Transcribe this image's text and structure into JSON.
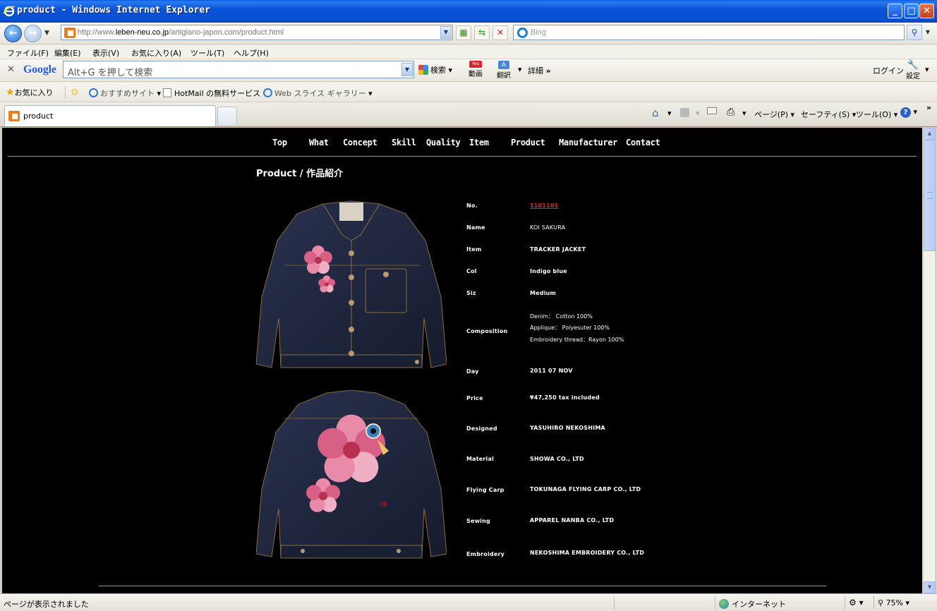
{
  "window": {
    "title": "product - Windows Internet Explorer",
    "minimize": "_",
    "maximize": "□",
    "close": "✕"
  },
  "address": {
    "url_prefix": "http://www.",
    "url_domain": "leben-neu.co.jp",
    "url_path": "/artigiano-japon.com/product.html",
    "search_placeholder": "Bing"
  },
  "menu": [
    "ファイル(F)",
    "編集(E)",
    "表示(V)",
    "お気に入り(A)",
    "ツール(T)",
    "ヘルプ(H)"
  ],
  "google_toolbar": {
    "logo": "Google",
    "search_placeholder": "Alt+G を押して検索",
    "search_label": "検索",
    "video_label": "動画",
    "translate_label": "翻訳",
    "details_label": "詳細",
    "login_label": "ログイン",
    "settings_label": "設定"
  },
  "favorites": {
    "favorites_label": "お気に入り",
    "suggested_sites": "おすすめサイト",
    "hotmail": "HotMail の無料サービス",
    "web_slice": "Web スライス ギャラリー"
  },
  "tab": {
    "label": "product"
  },
  "command_bar": {
    "page": "ページ(P)",
    "safety": "セーフティ(S)",
    "tools": "ツール(O)"
  },
  "site_nav": [
    "Top",
    "What",
    "Concept",
    "Skill",
    "Quality",
    "Item",
    "Product",
    "Manufacturer",
    "Contact"
  ],
  "page_title": "Product / 作品紹介",
  "spec": {
    "no_label": "No.",
    "no_value": "1101101",
    "name_label": "Name",
    "name_value": "KOI SAKURA",
    "item_label": "Item",
    "item_value": "TRACKER JACKET",
    "col_label": "Col",
    "col_value": "Indigo blue",
    "siz_label": "Siz",
    "siz_value": "Medium",
    "composition_label": "Composition",
    "composition_lines": [
      "Denim： Cotton 100%",
      "Applique： Polyesuter  100%",
      "Embroidery thread：Rayon 100%"
    ],
    "day_label": "Day",
    "day_value": "2011 07 NOV",
    "price_label": "Price",
    "price_value": "¥47,250 tax included",
    "designed_label": "Designed",
    "designed_value": "YASUHIRO NEKOSHIMA",
    "material_label": "Material",
    "material_value": "SHOWA CO., LTD",
    "flying_carp_label": "Flying Carp",
    "flying_carp_value": "TOKUNAGA FLYING CARP CO., LTD",
    "sewing_label": "Sewing",
    "sewing_value": "APPAREL NANBA CO., LTD",
    "embroidery_label": "Embroidery",
    "embroidery_value": "NEKOSHIMA EMBROIDERY  CO., LTD"
  },
  "status": {
    "text": "ページが表示されました",
    "zone": "インターネット",
    "zoom": "75%"
  },
  "colors": {
    "page_background": "#000000",
    "denim": "#1d2338",
    "link_red": "#e02525",
    "sakura_pink": "#e88aa8"
  }
}
